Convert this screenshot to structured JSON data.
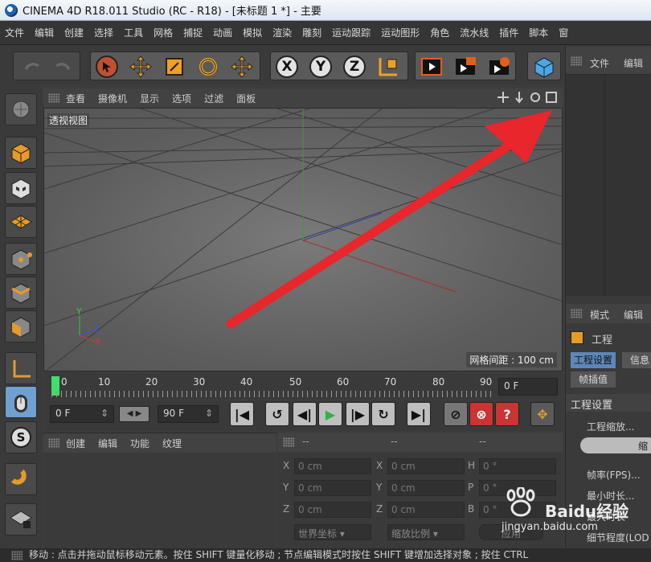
{
  "title_bar": {
    "title": "CINEMA 4D R18.011 Studio (RC - R18) - [未标题 1 *] - 主要"
  },
  "menu": [
    "文件",
    "编辑",
    "创建",
    "选择",
    "工具",
    "网格",
    "捕捉",
    "动画",
    "模拟",
    "渲染",
    "雕刻",
    "运动跟踪",
    "运动图形",
    "角色",
    "流水线",
    "插件",
    "脚本",
    "窗"
  ],
  "toolbar": {
    "axis_x": "X",
    "axis_y": "Y",
    "axis_z": "Z"
  },
  "viewport": {
    "menus": [
      "查看",
      "摄像机",
      "显示",
      "选项",
      "过滤",
      "面板"
    ],
    "label": "透视视图",
    "grid_info": "网格间距 : 100 cm"
  },
  "timeline": {
    "ticks": [
      "0",
      "10",
      "20",
      "30",
      "40",
      "50",
      "60",
      "70",
      "80",
      "90"
    ],
    "current_frame_field": "0 F"
  },
  "transport": {
    "start_field": "0 F",
    "end_field": "90 F"
  },
  "object_panel": {
    "menus": [
      "创建",
      "编辑",
      "功能",
      "纹理"
    ]
  },
  "coords": {
    "header": [
      "--",
      "--",
      "--"
    ],
    "rows": [
      {
        "a": "X",
        "av": "0 cm",
        "b": "X",
        "bv": "0 cm",
        "c": "H",
        "cv": "0 °"
      },
      {
        "a": "Y",
        "av": "0 cm",
        "b": "Y",
        "bv": "0 cm",
        "c": "P",
        "cv": "0 °"
      },
      {
        "a": "Z",
        "av": "0 cm",
        "b": "Z",
        "bv": "0 cm",
        "c": "B",
        "cv": "0 °"
      }
    ],
    "world_select": "世界坐标",
    "scale_select": "缩放比例",
    "apply_button": "应用"
  },
  "right_panel": {
    "top_menus": [
      "文件",
      "编辑"
    ],
    "mid_menus": [
      "模式",
      "编辑"
    ],
    "project_label": "工程",
    "tabs": [
      "工程设置",
      "信息"
    ],
    "subtab": "帧插值",
    "section": "工程设置",
    "fields": [
      "工程缩放...",
      "帧率(FPS)...",
      "最小时长...",
      "最大时长",
      "细节程度(LOD"
    ],
    "scale_button": "缩"
  },
  "status_bar": {
    "text": "移动 : 点击并拖动鼠标移动元素。按住 SHIFT 键量化移动 ; 节点编辑模式时按住 SHIFT 键增加选择对象 ; 按住 CTRL"
  },
  "watermark": {
    "logo": "Baidu经验",
    "url": "jingyan.baidu.com"
  },
  "colors": {
    "annotation_arrow": "#e8262b",
    "accent_orange": "#e59a2a",
    "play_green": "#2db24a"
  }
}
